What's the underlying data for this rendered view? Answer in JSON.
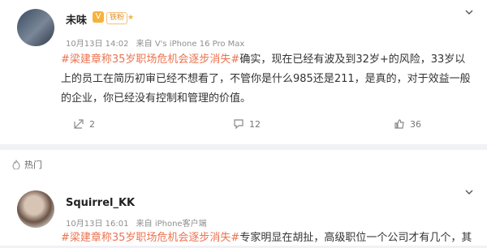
{
  "post": {
    "username": "未味",
    "vip_badge": "V",
    "fan_badge": "铁粉",
    "date": "10月13日 14:02",
    "source": "来自 V's iPhone 16 Pro Max",
    "hashtag": "#梁建章称35岁职场危机会逐步消失#",
    "text": "确实，现在已经有波及到32岁+的风险，33岁以上的员工在简历初审已经不想看了，不管你是什么985还是211，是真的，对于效益一般的企业，你已经没有控制和管理的价值。",
    "actions": {
      "repost_count": "2",
      "comment_count": "12",
      "like_count": "36"
    }
  },
  "hot_section": {
    "label": "热门"
  },
  "comment": {
    "username": "Squirrel_KK",
    "date": "10月13日 16:01",
    "source": "来自 iPhone客户端",
    "hashtag": "#梁建章称35岁职场危机会逐步消失#",
    "text": "专家明显在胡扯，高级职位一个公司才有几个，其"
  },
  "icons": {
    "more": "chevron-down-icon",
    "repost": "repost-icon",
    "comment": "comment-icon",
    "like": "thumbs-up-icon",
    "hot": "flame-icon"
  },
  "colors": {
    "hashtag": "#eb7350",
    "meta": "#8f8f8f",
    "background": "#f1f2f5"
  }
}
